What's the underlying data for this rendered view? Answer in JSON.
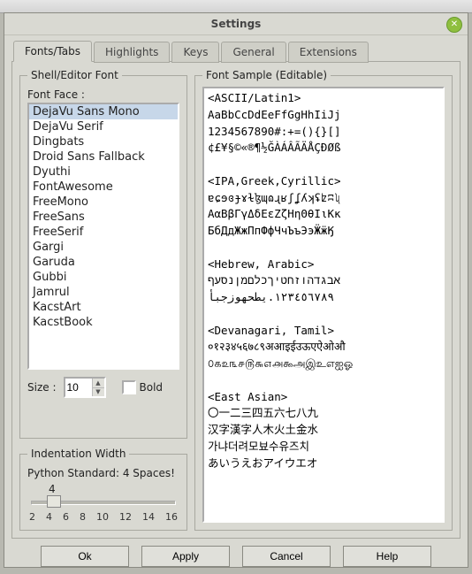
{
  "window": {
    "title": "Settings"
  },
  "tabs": [
    {
      "label": "Fonts/Tabs",
      "active": true
    },
    {
      "label": "Highlights",
      "active": false
    },
    {
      "label": "Keys",
      "active": false
    },
    {
      "label": "General",
      "active": false
    },
    {
      "label": "Extensions",
      "active": false
    }
  ],
  "fontPanel": {
    "legend": "Shell/Editor Font",
    "faceLabel": "Font Face :",
    "fonts": [
      "DejaVu Sans Mono",
      "DejaVu Serif",
      "Dingbats",
      "Droid Sans Fallback",
      "Dyuthi",
      "FontAwesome",
      "FreeMono",
      "FreeSans",
      "FreeSerif",
      "Gargi",
      "Garuda",
      "Gubbi",
      "Jamrul",
      "KacstArt",
      "KacstBook"
    ],
    "selected": "DejaVu Sans Mono",
    "sizeLabel": "Size :",
    "sizeValue": "10",
    "boldLabel": "Bold",
    "boldChecked": false
  },
  "indentPanel": {
    "legend": "Indentation Width",
    "pyStd": "Python Standard: 4 Spaces!",
    "value": "4",
    "ticks": [
      "2",
      "4",
      "6",
      "8",
      "10",
      "12",
      "14",
      "16"
    ]
  },
  "samplePanel": {
    "legend": "Font Sample (Editable)",
    "text": "<ASCII/Latin1>\nAaBbCcDdEeFfGgHhIiJj\n1234567890#:+=(){}[]\n¢£¥§©«®¶½ĞÀÁÂÃÄÅÇÐØß\n\n<IPA,Greek,Cyrillic>\nɐɕɘɞɟɤɫɮɰɷɻʁʃʆʎʞʢʫʭʯ\nΑαΒβΓγΔδΕεΖζΗηΘθΙιΚκ\nБбДдЖжПпФфЧчЪъЭэӜӝӃ\n\n<Hebrew, Arabic>\nאבגדהוזחטיךכלםמןנסעף\n١٢٣٤٥٦٧٨٩.يطحهوزجبأ\n\n<Devanagari, Tamil>\n०१२३४५६७८९अआइईउऊएऐओऔ\n௦௧௨௩௪௫௬௭௮௯அஇஉஎஐஓ\n\n<East Asian>\n〇一二三四五六七八九\n汉字漢字人木火土金水\n가냐더려모뵤수유즈치\nあいうえおアイウエオ\n"
  },
  "buttons": {
    "ok": "Ok",
    "apply": "Apply",
    "cancel": "Cancel",
    "help": "Help"
  }
}
